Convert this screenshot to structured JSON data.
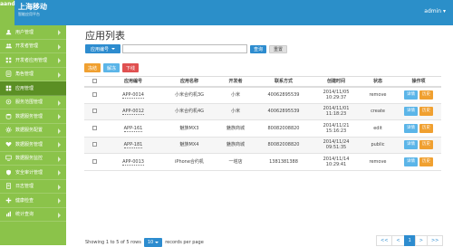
{
  "header": {
    "logo_text": "aand",
    "brand_name": "上海移动",
    "brand_sub": "智能应用平台",
    "user": "admin ▾"
  },
  "sidebar": {
    "items": [
      {
        "label": "用户管理",
        "icon": "user-icon",
        "active": false
      },
      {
        "label": "开发者管理",
        "icon": "users-icon",
        "active": false
      },
      {
        "label": "开发者应用管理",
        "icon": "grid-icon",
        "active": false
      },
      {
        "label": "角色管理",
        "icon": "role-icon",
        "active": false
      },
      {
        "label": "应用管理",
        "icon": "apps-icon",
        "active": true
      },
      {
        "label": "服务范围管理",
        "icon": "scope-icon",
        "active": false
      },
      {
        "label": "数据服务管理",
        "icon": "data-icon",
        "active": false
      },
      {
        "label": "数据服务配置",
        "icon": "config-icon",
        "active": false
      },
      {
        "label": "数据服务管理",
        "icon": "heart-icon",
        "active": false
      },
      {
        "label": "数据服务监控",
        "icon": "monitor-icon",
        "active": false
      },
      {
        "label": "安全审计管理",
        "icon": "shield-icon",
        "active": false
      },
      {
        "label": "日志管理",
        "icon": "log-icon",
        "active": false
      },
      {
        "label": "健康检查",
        "icon": "health-icon",
        "active": false
      },
      {
        "label": "统计查询",
        "icon": "chart-icon",
        "active": false
      }
    ]
  },
  "main": {
    "title": "应用列表",
    "search": {
      "field_label": "应用编号",
      "placeholder": "",
      "query_label": "查询",
      "reset_label": "重置"
    },
    "actions": {
      "freeze": "冻结",
      "thaw": "解冻",
      "offline": "下线"
    },
    "table": {
      "columns": [
        "应用编号",
        "应用名称",
        "开发者",
        "联系方式",
        "创建时间",
        "状态",
        "操作项"
      ],
      "rows": [
        {
          "code": "APP-0014",
          "name": "小米合约机3G",
          "dev": "小米",
          "contact": "40062895539",
          "time1": "2014/11/05",
          "time2": "10:29:37",
          "status": "remove"
        },
        {
          "code": "APP-0012",
          "name": "小米合约机4G",
          "dev": "小米",
          "contact": "40062895539",
          "time1": "2014/11/01",
          "time2": "11:18:23",
          "status": "create"
        },
        {
          "code": "APP-161",
          "name": "魅族MX3",
          "dev": "魅族商城",
          "contact": "80082008820",
          "time1": "2014/11/21",
          "time2": "15:16:23",
          "status": "edit"
        },
        {
          "code": "APP-181",
          "name": "魅族MX4",
          "dev": "魅族商城",
          "contact": "80082008820",
          "time1": "2014/11/24",
          "time2": "09:51:35",
          "status": "public"
        },
        {
          "code": "APP-0013",
          "name": "iPhone合约机",
          "dev": "一塔店",
          "contact": "1381381388",
          "time1": "2014/11/14",
          "time2": "10:29:41",
          "status": "remove"
        }
      ],
      "detail_label": "详情",
      "history_label": "历史"
    },
    "footer": {
      "showing": "Showing 1 to 5 of 5 rows",
      "page_size": "10",
      "per_page": "records per page"
    },
    "pager": {
      "first": "<<",
      "prev": "<",
      "current": "1",
      "next": ">",
      "last": ">>"
    }
  },
  "colors": {
    "topbar": "#2b8fc9",
    "sidebar": "#8bc34a",
    "sidebar_active": "#5b8f24",
    "primary": "#2d8ccf",
    "warning": "#f0a030",
    "danger": "#e05050",
    "info": "#5bb5e8"
  }
}
